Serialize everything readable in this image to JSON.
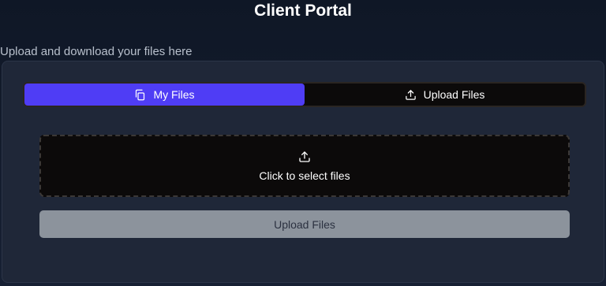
{
  "header": {
    "title": "Client Portal",
    "subtitle": "Upload and download your files here"
  },
  "tabs": [
    {
      "label": "My Files",
      "icon": "copy-icon",
      "active": true
    },
    {
      "label": "Upload Files",
      "icon": "upload-icon",
      "active": false
    }
  ],
  "dropzone": {
    "icon": "upload-icon",
    "label": "Click to select files"
  },
  "upload_button": {
    "label": "Upload Files",
    "disabled": true
  },
  "colors": {
    "accent": "#4f3df5",
    "disabled_button": "#8c939c",
    "card": "#1f2738",
    "background": "#0f1726"
  }
}
